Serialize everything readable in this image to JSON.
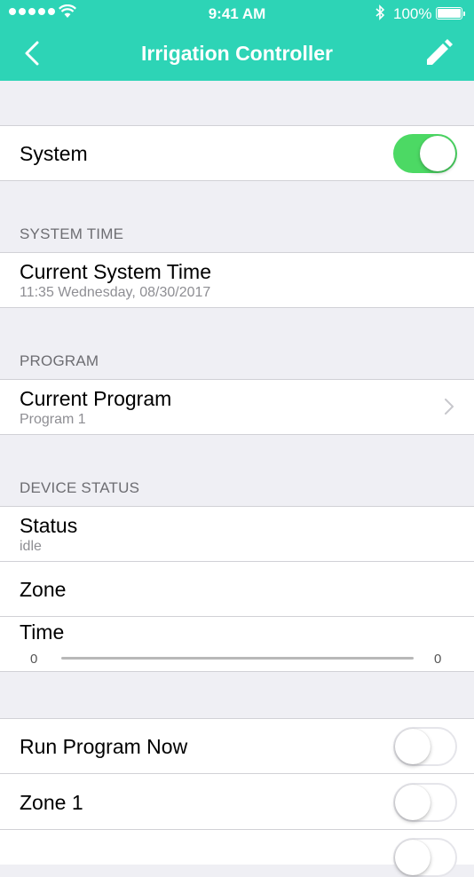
{
  "status_bar": {
    "time": "9:41 AM",
    "battery": "100%"
  },
  "nav": {
    "title": "Irrigation Controller",
    "back_icon": "chevron-left-icon",
    "edit_icon": "pencil-icon"
  },
  "system": {
    "label": "System",
    "enabled": true
  },
  "sections": {
    "system_time": {
      "header": "SYSTEM TIME",
      "title": "Current System Time",
      "value": "11:35 Wednesday, 08/30/2017"
    },
    "program": {
      "header": "PROGRAM",
      "title": "Current Program",
      "value": "Program 1"
    },
    "device_status": {
      "header": "DEVICE STATUS",
      "status_label": "Status",
      "status_value": "idle",
      "zone_label": "Zone",
      "time_label": "Time",
      "time_min": "0",
      "time_max": "0"
    }
  },
  "controls": {
    "run_program_label": "Run Program Now",
    "run_program_on": false,
    "zone1_label": "Zone 1",
    "zone1_on": false
  },
  "colors": {
    "accent": "#2dd4b6",
    "toggle_on": "#4cd964",
    "background": "#efeff4"
  }
}
